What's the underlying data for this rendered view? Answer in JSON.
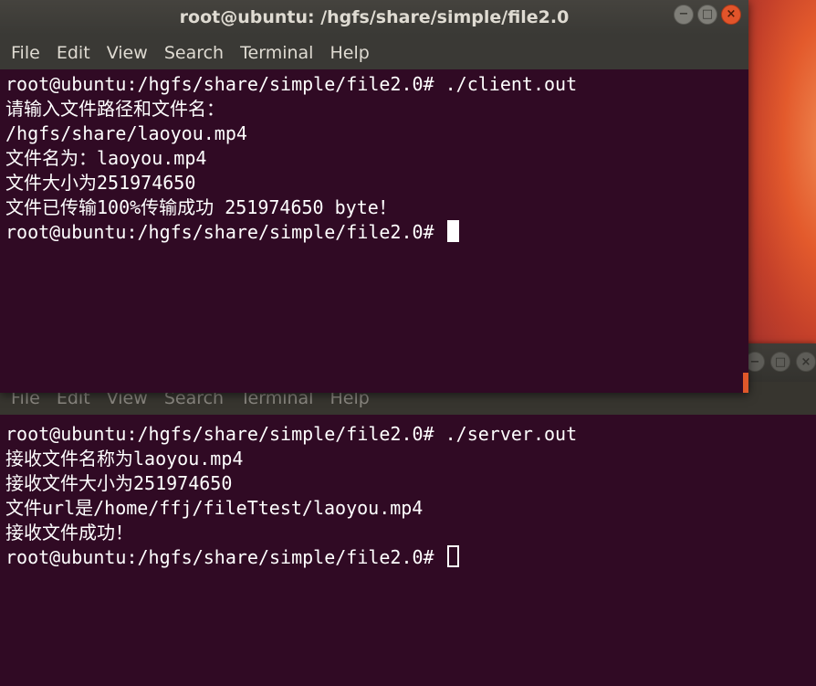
{
  "front": {
    "title": "root@ubuntu: /hgfs/share/simple/file2.0",
    "menu": [
      "File",
      "Edit",
      "View",
      "Search",
      "Terminal",
      "Help"
    ],
    "lines": [
      "root@ubuntu:/hgfs/share/simple/file2.0# ./client.out",
      "请输入文件路径和文件名：",
      "/hgfs/share/laoyou.mp4",
      "文件名为：laoyou.mp4",
      "文件大小为251974650",
      "文件已传输100%传输成功 251974650 byte！"
    ],
    "prompt": "root@ubuntu:/hgfs/share/simple/file2.0# "
  },
  "back": {
    "menu": [
      "File",
      "Edit",
      "View",
      "Search",
      "Terminal",
      "Help"
    ],
    "lines": [
      "root@ubuntu:/hgfs/share/simple/file2.0# ./server.out",
      "接收文件名称为laoyou.mp4",
      "接收文件大小为251974650",
      "文件url是/home/ffj/fileTtest/laoyou.mp4",
      "接收文件成功！"
    ],
    "prompt": "root@ubuntu:/hgfs/share/simple/file2.0# "
  },
  "icons": {
    "minimize": "−",
    "maximize": "□",
    "close": "×"
  },
  "colors": {
    "terminal_bg": "#300a24",
    "accent": "#e2542a"
  }
}
